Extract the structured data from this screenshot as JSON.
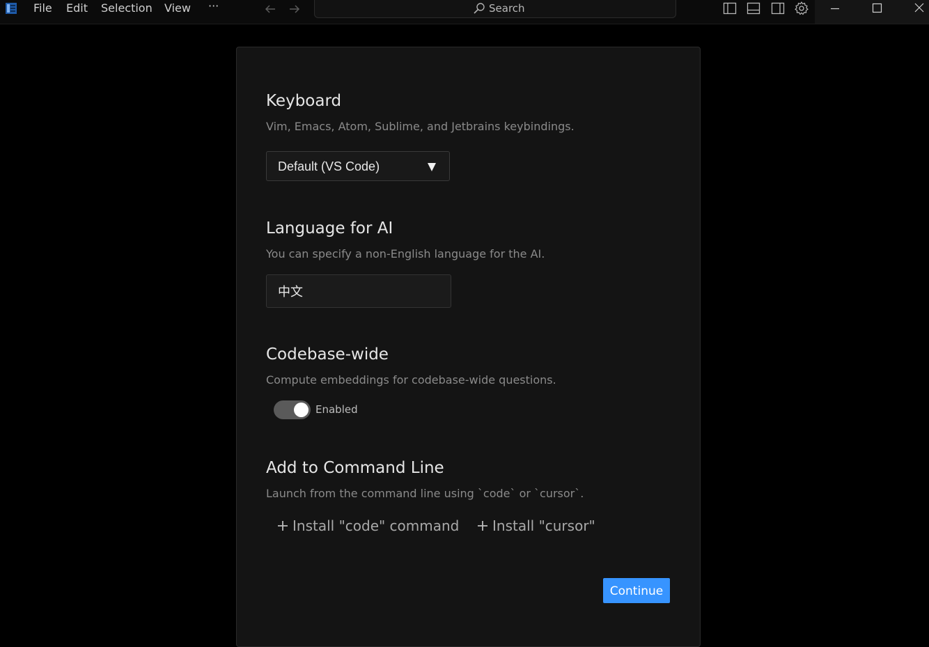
{
  "titlebar": {
    "menu": [
      "File",
      "Edit",
      "Selection",
      "View",
      "···"
    ],
    "search_placeholder": "Search",
    "icons": [
      "app-logo-icon",
      "arrow-left-icon",
      "arrow-right-icon",
      "search-icon",
      "toggle-primary-sidebar-icon",
      "toggle-panel-icon",
      "toggle-secondary-sidebar-icon",
      "gear-icon",
      "minimize-icon",
      "maximize-icon",
      "close-icon"
    ]
  },
  "onboarding": {
    "keyboard": {
      "title": "Keyboard",
      "description": "Vim, Emacs, Atom, Sublime, and Jetbrains keybindings.",
      "selected": "Default (VS Code)"
    },
    "language": {
      "title": "Language for AI",
      "description": "You can specify a non-English language for the AI.",
      "value": "中文"
    },
    "codebase": {
      "title": "Codebase-wide",
      "description": "Compute embeddings for codebase-wide questions.",
      "toggle_label": "Enabled",
      "enabled": true
    },
    "command_line": {
      "title": "Add to Command Line",
      "description": "Launch from the command line using `code` or `cursor`.",
      "install_code": "Install \"code\" command",
      "install_cursor": "Install \"cursor\""
    },
    "continue_label": "Continue"
  },
  "colors": {
    "background": "#000000",
    "panel": "#141414",
    "accent": "#3794ff",
    "toggle_track": "#5a5a5a"
  }
}
